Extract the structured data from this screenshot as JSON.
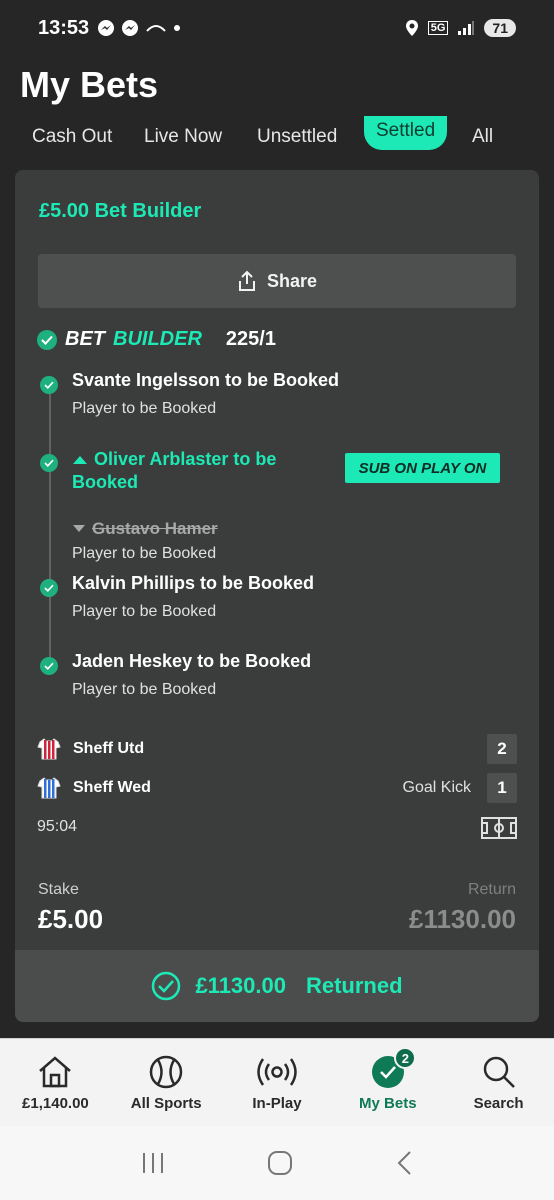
{
  "status_bar": {
    "time": "13:53",
    "battery": "71",
    "network": "5G"
  },
  "page": {
    "title": "My Bets"
  },
  "tabs": [
    {
      "label": "Cash Out"
    },
    {
      "label": "Live Now"
    },
    {
      "label": "Unsettled"
    },
    {
      "label": "Settled",
      "active": true
    },
    {
      "label": "All"
    }
  ],
  "bet": {
    "title": "£5.00 Bet Builder",
    "share_label": "Share",
    "builder_word1": "BET",
    "builder_word2": "BUILDER",
    "odds": "225/1",
    "legs": [
      {
        "name": "Svante Ingelsson to be Booked",
        "market": "Player to be Booked"
      },
      {
        "name": "Oliver Arblaster to be Booked",
        "removed": "Gustavo Hamer",
        "market": "Player to be Booked",
        "badge": "SUB ON PLAY ON"
      },
      {
        "name": "Kalvin Phillips to be Booked",
        "market": "Player to be Booked"
      },
      {
        "name": "Jaden Heskey to be Booked",
        "market": "Player to be Booked"
      }
    ],
    "match": {
      "home": {
        "team": "Sheff Utd",
        "score": "2"
      },
      "away": {
        "team": "Sheff Wed",
        "score": "1",
        "event": "Goal Kick"
      },
      "time": "95:04"
    },
    "stake_label": "Stake",
    "stake": "£5.00",
    "return_label": "Return",
    "return": "£1130.00",
    "returned_amount": "£1130.00",
    "returned_text": "Returned"
  },
  "bottom_nav": [
    {
      "label": "£1,140.00",
      "icon": "home-icon"
    },
    {
      "label": "All Sports",
      "icon": "ball-icon"
    },
    {
      "label": "In-Play",
      "icon": "live-icon"
    },
    {
      "label": "My Bets",
      "icon": "check-circle-icon",
      "badge": "2",
      "active": true
    },
    {
      "label": "Search",
      "icon": "search-icon"
    }
  ],
  "colors": {
    "accent": "#1de9b6",
    "card": "#3a3d3b",
    "background": "#262626",
    "nav_active": "#0f7a56"
  }
}
